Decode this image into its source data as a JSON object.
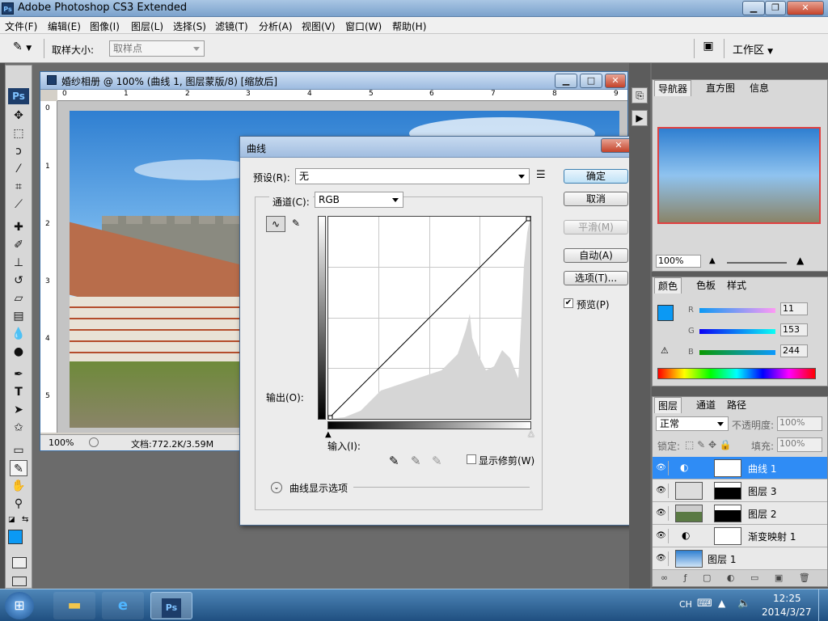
{
  "app": {
    "window_title": "Adobe Photoshop CS3 Extended",
    "ps_badge": "Ps"
  },
  "menu": [
    "文件(F)",
    "编辑(E)",
    "图像(I)",
    "图层(L)",
    "选择(S)",
    "滤镜(T)",
    "分析(A)",
    "视图(V)",
    "窗口(W)",
    "帮助(H)"
  ],
  "options_bar": {
    "sample_size_label": "取样大小:",
    "sample_size_value": "取样点",
    "workspace_label": "工作区"
  },
  "document": {
    "title": "婚纱相册 @ 100% (曲线 1, 图层蒙版/8) [缩放后]",
    "ruler_h": [
      "0",
      "1",
      "2",
      "3",
      "4",
      "5",
      "6",
      "7",
      "8",
      "9"
    ],
    "ruler_v": [
      "0",
      "1",
      "2",
      "3",
      "4",
      "5"
    ],
    "zoom": "100%",
    "doc_info": "文档:772.2K/3.59M"
  },
  "curves_dialog": {
    "title": "曲线",
    "preset_label": "预设(R):",
    "preset_value": "无",
    "channel_label": "通道(C):",
    "channel_value": "RGB",
    "output_label": "输出(O):",
    "input_label": "输入(I):",
    "show_clipping_label": "显示修剪(W)",
    "curve_display_label": "曲线显示选项",
    "buttons": {
      "ok": "确定",
      "cancel": "取消",
      "smooth": "平滑(M)",
      "auto": "自动(A)",
      "options": "选项(T)...",
      "preview": "预览(P)"
    },
    "preview_checked": true
  },
  "navigator_panel": {
    "tabs": [
      "导航器",
      "直方图",
      "信息"
    ],
    "zoom": "100%"
  },
  "color_panel": {
    "tabs": [
      "颜色",
      "色板",
      "样式"
    ],
    "channels": [
      {
        "label": "R",
        "value": "11"
      },
      {
        "label": "G",
        "value": "153"
      },
      {
        "label": "B",
        "value": "244"
      }
    ],
    "foreground_color": "#0b99f4"
  },
  "layers_panel": {
    "tabs": [
      "图层",
      "通道",
      "路径"
    ],
    "blend_mode": "正常",
    "opacity_label": "不透明度:",
    "opacity_value": "100%",
    "lock_label": "锁定:",
    "fill_label": "填充:",
    "fill_value": "100%",
    "layers": [
      {
        "name": "曲线 1",
        "selected": true
      },
      {
        "name": "图层 3",
        "selected": false
      },
      {
        "name": "图层 2",
        "selected": false
      },
      {
        "name": "渐变映射 1",
        "selected": false
      },
      {
        "name": "图层 1",
        "selected": false
      }
    ]
  },
  "taskbar": {
    "lang": "CH",
    "time": "12:25",
    "date": "2014/3/27",
    "ps_label": "Ps"
  },
  "colors": {
    "accent": "#2f8cf5",
    "title_bar": "#a9c6e4"
  }
}
